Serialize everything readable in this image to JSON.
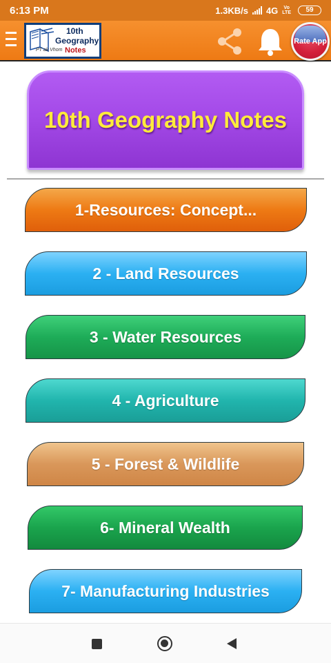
{
  "status_bar": {
    "time": "6:13 PM",
    "network_speed": "1.3KB/s",
    "network_type": "4G",
    "volte_top": "Vo",
    "volte_bottom": "LTE",
    "battery": "59"
  },
  "app_bar": {
    "logo": {
      "line1": "10th",
      "line2": "Geography",
      "line3": "Notes",
      "script": "PT ak Vhom"
    },
    "rate_label": "Rate App"
  },
  "title": "10th Geography Notes",
  "chapters": [
    {
      "label": "1-Resources: Concept..."
    },
    {
      "label": "2 - Land Resources"
    },
    {
      "label": "3 - Water Resources"
    },
    {
      "label": "4 - Agriculture"
    },
    {
      "label": "5 - Forest & Wildlife"
    },
    {
      "label": "6- Mineral Wealth"
    },
    {
      "label": "7- Manufacturing Industries"
    }
  ],
  "colors": {
    "status_bar": "#d9771c",
    "app_bar": "#f6902e",
    "title_card": "#a44ae8",
    "title_text": "#ffeb3b"
  }
}
